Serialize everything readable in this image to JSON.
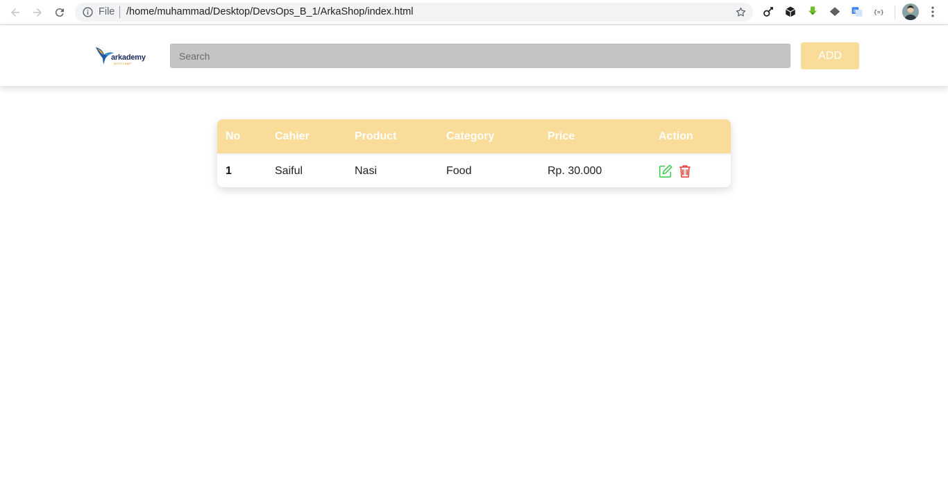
{
  "browser": {
    "scheme_label": "File",
    "url": "/home/muhammad/Desktop/DevsOps_B_1/ArkaShop/index.html"
  },
  "header": {
    "logo_text": "arkademy",
    "logo_subtext": "BOOTCAMP",
    "search": {
      "placeholder": "Search",
      "value": ""
    },
    "add_label": "ADD"
  },
  "table": {
    "columns": [
      "No",
      "Cahier",
      "Product",
      "Category",
      "Price",
      "Action"
    ],
    "rows": [
      {
        "no": "1",
        "cahier": "Saiful",
        "product": "Nasi",
        "category": "Food",
        "price": "Rp. 30.000"
      }
    ]
  },
  "colors": {
    "accent": "#f9dc9a",
    "edit": "#2ecc40",
    "delete": "#e53935",
    "search_bg": "#c4c4c4"
  }
}
